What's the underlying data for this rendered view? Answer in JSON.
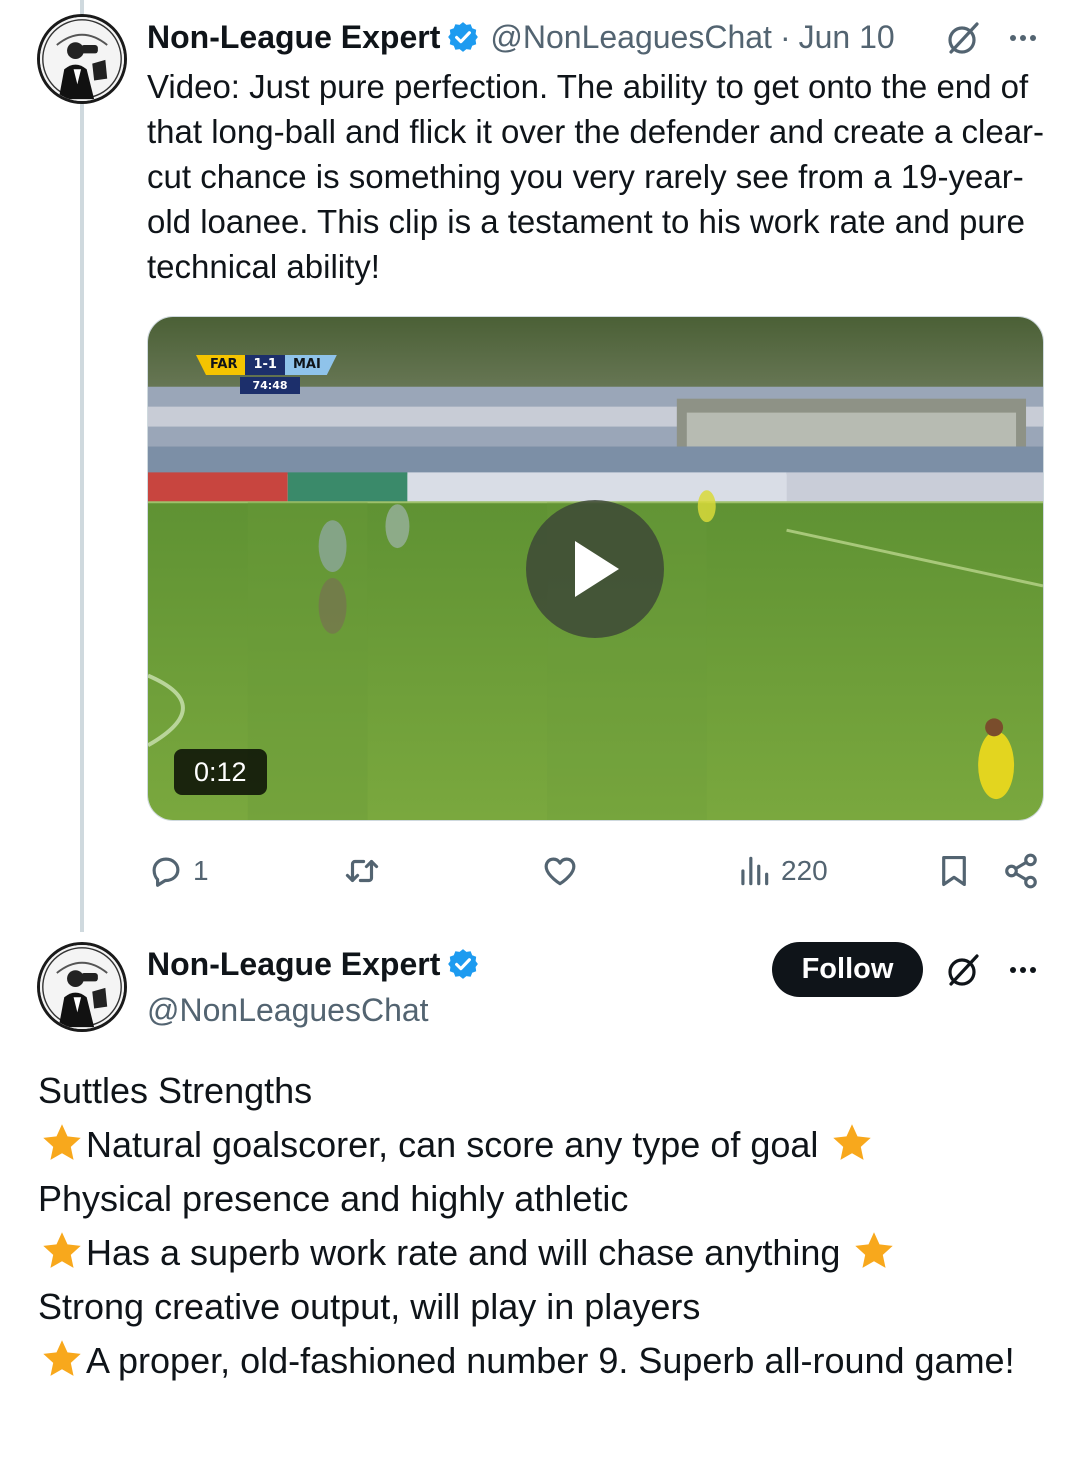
{
  "tweet1": {
    "author_name": "Non-League Expert",
    "handle": "@NonLeaguesChat",
    "separator": "·",
    "date": "Jun 10",
    "text": "Video: Just pure perfection. The ability to get onto the end of that long-ball and flick it over the defender and create a clear-cut chance is something you very rarely see from a 19-year-old loanee. This clip is a testament to his work rate and pure technical ability!",
    "video": {
      "scoreboard": {
        "home": "FAR",
        "score": "1-1",
        "away": "MAI",
        "clock": "74:48"
      },
      "duration": "0:12"
    },
    "actions": {
      "reply": {
        "icon": "reply-icon",
        "count": "1"
      },
      "retweet": {
        "icon": "retweet-icon",
        "count": ""
      },
      "like": {
        "icon": "heart-icon",
        "count": ""
      },
      "views": {
        "icon": "views-icon",
        "count": "220"
      },
      "bookmark": {
        "icon": "bookmark-icon"
      },
      "share": {
        "icon": "share-icon"
      }
    }
  },
  "tweet2": {
    "author_name": "Non-League Expert",
    "handle": "@NonLeaguesChat",
    "follow_label": "Follow",
    "lines": [
      {
        "star_before": false,
        "text": "Suttles Strengths",
        "star_after": false
      },
      {
        "star_before": true,
        "text": "Natural goalscorer, can score any type of goal ",
        "star_after": true
      },
      {
        "star_before": false,
        "text": "Physical presence and highly athletic",
        "star_after": false
      },
      {
        "star_before": true,
        "text": "Has a superb work rate and will chase anything ",
        "star_after": true
      },
      {
        "star_before": false,
        "text": "Strong creative output, will play in players",
        "star_after": false
      },
      {
        "star_before": true,
        "text": "A proper, old-fashioned number 9. Superb all-round game!",
        "star_after": false
      }
    ]
  },
  "colors": {
    "text_primary": "#0f1419",
    "text_secondary": "#536471",
    "verified_blue": "#1d9bf0",
    "star": "#f8a81c",
    "thread_line": "#cfd9de"
  }
}
